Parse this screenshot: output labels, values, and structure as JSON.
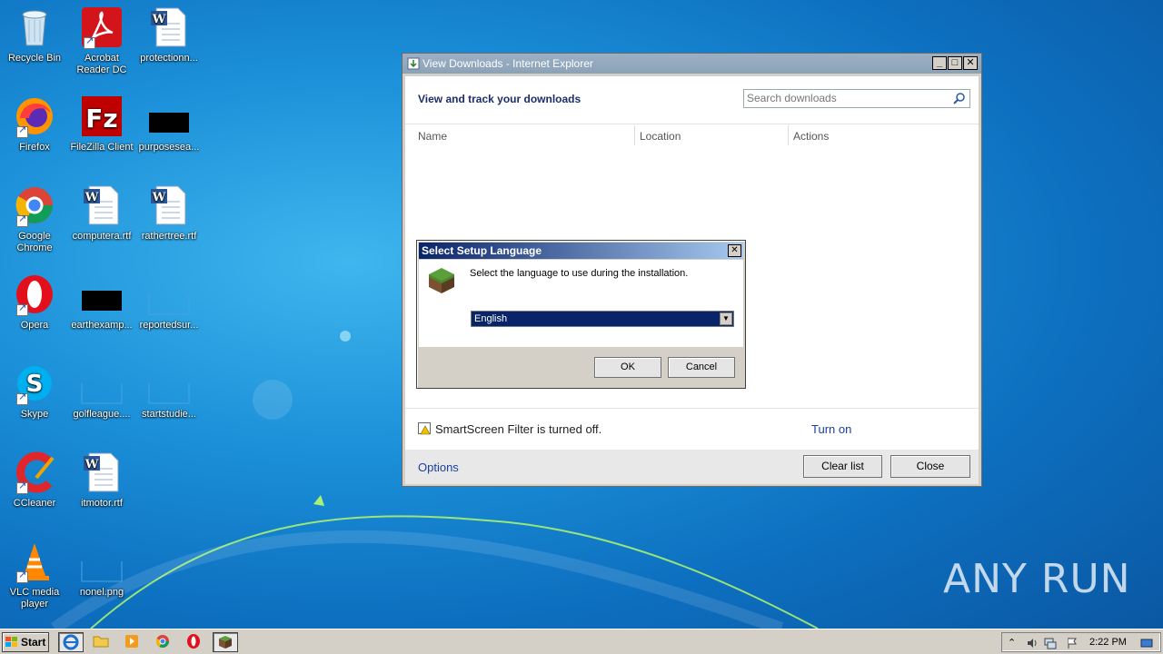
{
  "desktop": {
    "icons": [
      {
        "label": "Recycle Bin"
      },
      {
        "label": "Acrobat Reader DC"
      },
      {
        "label": "protectionn..."
      },
      {
        "label": "Firefox"
      },
      {
        "label": "FileZilla Client"
      },
      {
        "label": "purposesea..."
      },
      {
        "label": "Google Chrome"
      },
      {
        "label": "computera.rtf"
      },
      {
        "label": "rathertree.rtf"
      },
      {
        "label": "Opera"
      },
      {
        "label": "earthexamp..."
      },
      {
        "label": "reportedsur..."
      },
      {
        "label": "Skype"
      },
      {
        "label": "golfleague...."
      },
      {
        "label": "startstudie..."
      },
      {
        "label": "CCleaner"
      },
      {
        "label": "itmotor.rtf"
      },
      {
        "label": "VLC media player"
      },
      {
        "label": "nonel.png"
      }
    ],
    "watermark": "ANY RUN"
  },
  "ie_window": {
    "title": "View Downloads - Internet Explorer",
    "heading": "View and track your downloads",
    "search_placeholder": "Search downloads",
    "columns": [
      "Name",
      "Location",
      "Actions"
    ],
    "smartscreen_text": "SmartScreen Filter is turned off.",
    "turn_on_link": "Turn on",
    "options_link": "Options",
    "clear_list_button": "Clear list",
    "close_button": "Close"
  },
  "setup_dialog": {
    "title": "Select Setup Language",
    "prompt": "Select the language to use during the installation.",
    "selected_language": "English",
    "ok_button": "OK",
    "cancel_button": "Cancel"
  },
  "taskbar": {
    "start_label": "Start",
    "clock": "2:22 PM"
  },
  "colors": {
    "accent_title": "#0a246a",
    "link": "#1a3fa0"
  }
}
